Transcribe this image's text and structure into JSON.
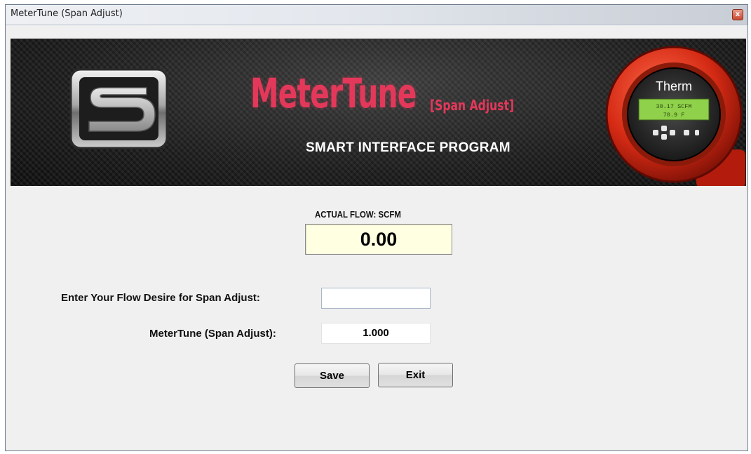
{
  "window": {
    "title": "MeterTune (Span Adjust)",
    "close_glyph": "x"
  },
  "banner": {
    "brand_name": "MeterTune",
    "brand_suffix": "[Span Adjust]",
    "tagline": "SMART INTERFACE PROGRAM",
    "logo_letter": "S",
    "device_brand": "Therm",
    "device_line1": "30.17  SCFM",
    "device_line2": "70.9   F",
    "accent_color": "#e4385a"
  },
  "flow": {
    "label": "ACTUAL FLOW: SCFM",
    "value": "0.00"
  },
  "form": {
    "desired_flow_label": "Enter Your Flow Desire for Span Adjust:",
    "desired_flow_value": "",
    "span_label": "MeterTune (Span Adjust):",
    "span_value": "1.000"
  },
  "buttons": {
    "save": "Save",
    "exit": "Exit"
  }
}
